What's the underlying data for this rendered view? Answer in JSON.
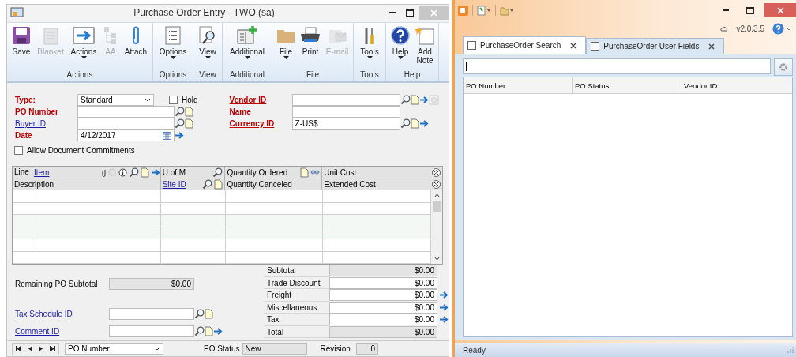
{
  "entry_window": {
    "title": "Purchase Order Entry  -  TWO (sa)",
    "ribbon": [
      {
        "group": "Actions",
        "buttons": [
          {
            "label": "Save",
            "disabled": false,
            "dropdown": false
          },
          {
            "label": "Blanket",
            "disabled": true,
            "dropdown": false
          },
          {
            "label": "Actions",
            "disabled": false,
            "dropdown": true
          },
          {
            "label": "AA",
            "disabled": true,
            "dropdown": false
          },
          {
            "label": "Attach",
            "disabled": false,
            "dropdown": false
          }
        ]
      },
      {
        "group": "Options",
        "buttons": [
          {
            "label": "Options",
            "disabled": false,
            "dropdown": true
          }
        ]
      },
      {
        "group": "View",
        "buttons": [
          {
            "label": "View",
            "disabled": false,
            "dropdown": true
          }
        ]
      },
      {
        "group": "Additional",
        "buttons": [
          {
            "label": "Additional",
            "disabled": false,
            "dropdown": true
          }
        ]
      },
      {
        "group": "File",
        "buttons": [
          {
            "label": "File",
            "disabled": false,
            "dropdown": true
          },
          {
            "label": "Print",
            "disabled": false,
            "dropdown": false
          },
          {
            "label": "E-mail",
            "disabled": true,
            "dropdown": false
          }
        ]
      },
      {
        "group": "Tools",
        "buttons": [
          {
            "label": "Tools",
            "disabled": false,
            "dropdown": true
          }
        ]
      },
      {
        "group": "Help",
        "buttons": [
          {
            "label": "Help",
            "disabled": false,
            "dropdown": true
          },
          {
            "label": "Add Note",
            "disabled": false,
            "dropdown": false
          }
        ]
      }
    ],
    "type_field": {
      "label": "Type:",
      "kind": "required",
      "value": "Standard"
    },
    "hold": {
      "label": "Hold",
      "checked": false
    },
    "fields_left": [
      {
        "label": "PO Number",
        "kind": "required"
      },
      {
        "label": "Buyer ID",
        "kind": "link"
      },
      {
        "label": "Date",
        "kind": "required",
        "value": "4/12/2017"
      }
    ],
    "fields_right": [
      {
        "label": "Vendor ID",
        "kind": "required_link"
      },
      {
        "label": "Name",
        "kind": "required"
      },
      {
        "label": "Currency ID",
        "kind": "required_link",
        "value": "Z-US$"
      }
    ],
    "commitments": {
      "label": "Allow Document Commitments",
      "checked": false
    },
    "grid": {
      "line": "Line",
      "item": "Item",
      "u_of_m": "U of M",
      "quantity_ordered": "Quantity Ordered",
      "unit_cost": "Unit Cost",
      "description": "Description",
      "site_id": "Site ID",
      "quantity_canceled": "Quantity Canceled",
      "extended_cost": "Extended Cost"
    },
    "remaining": {
      "label": "Remaining PO Subtotal",
      "value": "$0.00"
    },
    "lower_fields": [
      {
        "label": "Tax Schedule ID",
        "kind": "link"
      },
      {
        "label": "Comment ID",
        "kind": "link"
      }
    ],
    "totals": [
      {
        "label": "Subtotal",
        "value": "$0.00",
        "editable": false,
        "arrow": false
      },
      {
        "label": "Trade Discount",
        "value": "$0.00",
        "editable": true,
        "arrow": false
      },
      {
        "label": "Freight",
        "value": "$0.00",
        "editable": true,
        "arrow": true
      },
      {
        "label": "Miscellaneous",
        "value": "$0.00",
        "editable": true,
        "arrow": true
      },
      {
        "label": "Tax",
        "value": "$0.00",
        "editable": true,
        "arrow": true
      },
      {
        "label": "Total",
        "value": "$0.00",
        "editable": false,
        "arrow": false
      }
    ],
    "footer": {
      "browse_by": "PO Number",
      "status_label": "PO Status",
      "status": "New",
      "revision_label": "Revision",
      "revision": "0"
    }
  },
  "search_window": {
    "version": "v2.0.3.5",
    "tabs": [
      {
        "label": "PurchaseOrder Search",
        "selected": true
      },
      {
        "label": "PurchaseOrder User Fields",
        "selected": false
      }
    ],
    "columns": [
      "PO Number",
      "PO Status",
      "Vendor ID"
    ],
    "status_bar": "Ready"
  }
}
